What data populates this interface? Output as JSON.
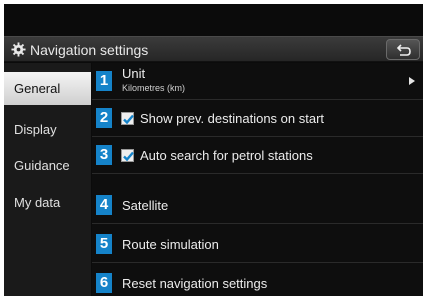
{
  "header": {
    "title": "Navigation settings",
    "icon": "gear-icon",
    "back_icon": "back-arrow-icon"
  },
  "sidebar": {
    "items": [
      {
        "label": "General",
        "active": true
      },
      {
        "label": "Display",
        "active": false
      },
      {
        "label": "Guidance",
        "active": false
      },
      {
        "label": "My data",
        "active": false
      }
    ]
  },
  "settings": [
    {
      "number": "1",
      "label": "Unit",
      "value": "Kilometres (km)"
    },
    {
      "number": "2",
      "label": "Show prev. destinations on start",
      "checked": true
    },
    {
      "number": "3",
      "label": "Auto search for petrol stations",
      "checked": true
    },
    {
      "number": "4",
      "label": "Satellite"
    },
    {
      "number": "5",
      "label": "Route simulation"
    },
    {
      "number": "6",
      "label": "Reset navigation settings"
    }
  ],
  "colors": {
    "badge": "#1583c9",
    "background": "#0b0b0b",
    "active_tab": "#e6e6e6"
  }
}
